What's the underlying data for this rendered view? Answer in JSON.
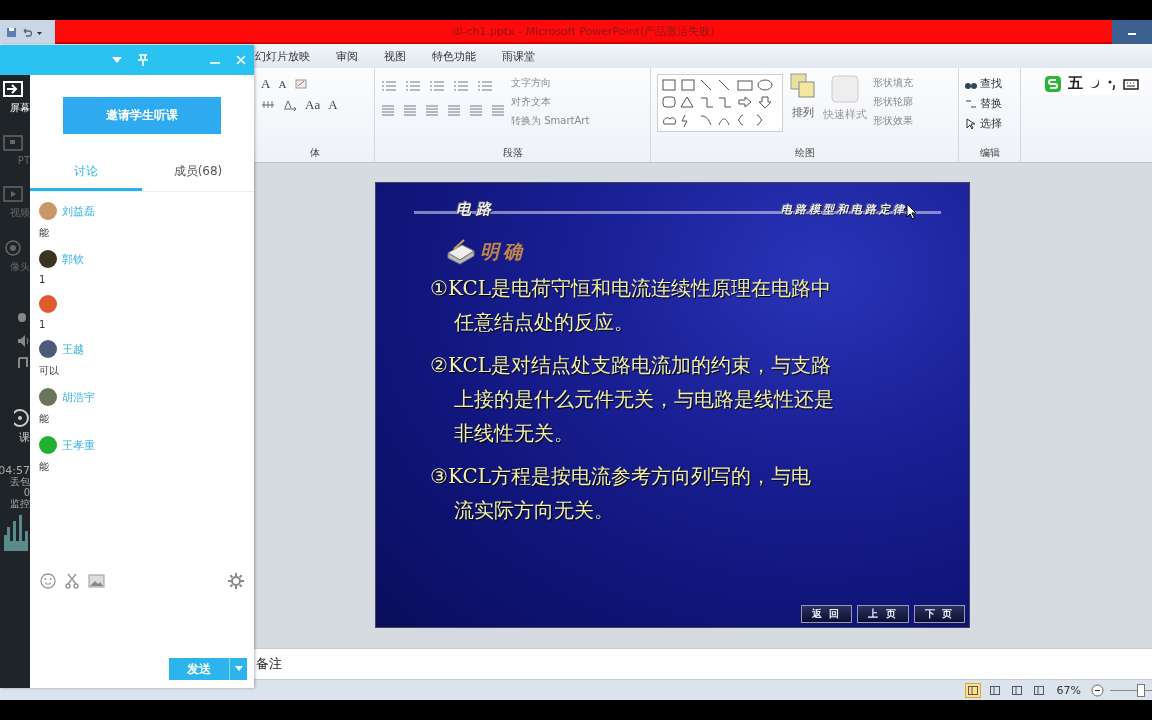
{
  "title_bar": {
    "title": "dl-ch1.pptx - Microsoft PowerPoint(产品激活失败)"
  },
  "ribbon_tabs": [
    {
      "label": "幻灯片放映"
    },
    {
      "label": "审阅"
    },
    {
      "label": "视图"
    },
    {
      "label": "特色功能"
    },
    {
      "label": "雨课堂"
    }
  ],
  "font_group": {
    "buttons": [
      "A",
      "A",
      "Aa",
      "A"
    ],
    "label": "体"
  },
  "paragraph_group": {
    "commands": [
      "文字方向",
      "对齐文本",
      "转换为 SmartArt"
    ],
    "label": "段落"
  },
  "drawing_group": {
    "arrange": "排列",
    "quick_styles": "快速样式",
    "commands": [
      "形状填充",
      "形状轮廓",
      "形状效果"
    ],
    "label": "绘图"
  },
  "editing_group": {
    "commands": [
      "查找",
      "替换",
      "选择"
    ],
    "label": "编辑"
  },
  "ime_bar": {
    "mode": "五"
  },
  "slide": {
    "header_left": "电 路",
    "header_right": "电路模型和电路定律",
    "heading": "明确",
    "points": [
      {
        "lines": [
          "①KCL是电荷守恒和电流连续性原理在电路中",
          "任意结点处的反应。"
        ]
      },
      {
        "lines": [
          "②KCL是对结点处支路电流加的约束，与支路",
          "上接的是什么元件无关，与电路是线性还是",
          "非线性无关。"
        ]
      },
      {
        "lines": [
          "③KCL方程是按电流参考方向列写的，与电",
          "流实际方向无关。"
        ]
      }
    ],
    "nav_buttons": [
      "返 回",
      "上 页",
      "下 页"
    ]
  },
  "notes": {
    "text": "备注"
  },
  "status_bar": {
    "views": [
      {
        "selected": true
      },
      {
        "selected": false
      },
      {
        "selected": false
      },
      {
        "selected": false
      }
    ],
    "zoom": "67%"
  },
  "classroom_panel": {
    "sidebar": [
      {
        "kind": "screen",
        "label": "屏幕",
        "selected": true
      },
      {
        "kind": "ppt",
        "label": "PT",
        "selected": false
      },
      {
        "kind": "video",
        "label": "视频",
        "selected": false
      },
      {
        "kind": "camera",
        "label": "像头",
        "selected": false
      }
    ],
    "end_class": "课",
    "stats": [
      "04:57",
      "丢包",
      "0",
      "监控"
    ],
    "invite_button": "邀请学生听课",
    "tabs": [
      {
        "label": "讨论",
        "selected": true
      },
      {
        "label": "成员(68)",
        "selected": false
      }
    ],
    "messages": [
      {
        "name": "刘益磊",
        "text": "能",
        "color": "#c89868"
      },
      {
        "name": "郭钦",
        "text": "1",
        "color": "#3a3420"
      },
      {
        "text": "1",
        "color": "#e05a30"
      },
      {
        "name": "王越",
        "text": "可以",
        "color": "#4a5a78"
      },
      {
        "name": "胡浩宇",
        "text": "能",
        "color": "#6a7458"
      },
      {
        "name": "王孝重",
        "text": "能",
        "color": "#22b033"
      }
    ],
    "send_button": "发送"
  }
}
